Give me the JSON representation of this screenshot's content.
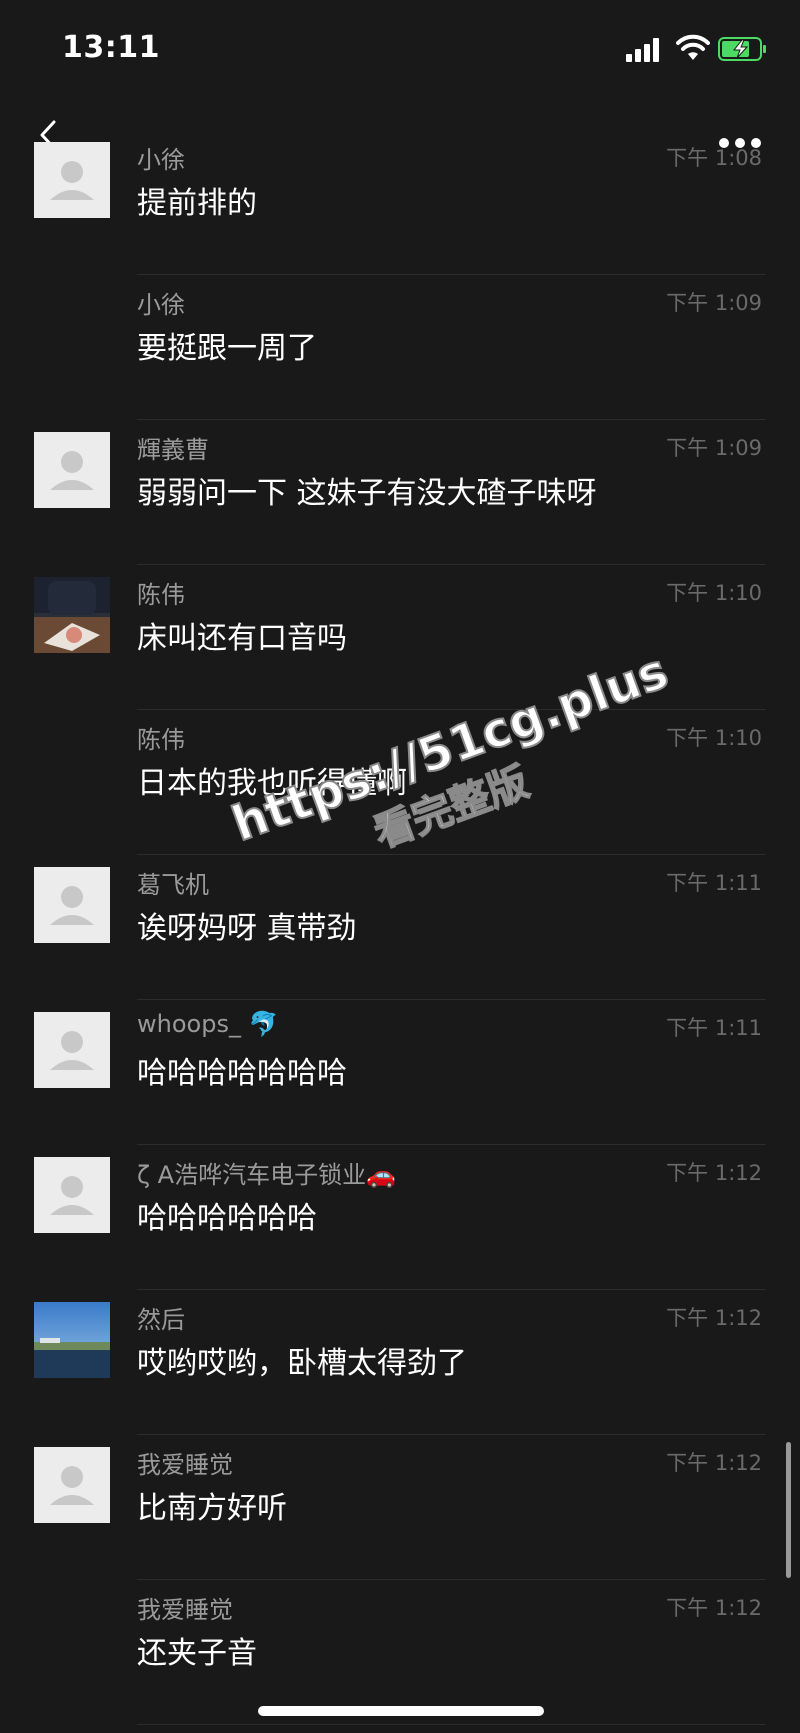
{
  "status_bar": {
    "time": "13:11"
  },
  "icons": {
    "back": "back-arrow-icon",
    "more": "more-dots-icon",
    "signal": "cellular-signal-icon",
    "wifi": "wifi-icon",
    "battery": "battery-charging-icon"
  },
  "colors": {
    "background": "#191919",
    "name": "#9a9a9a",
    "timestamp": "#6a6a6a",
    "battery": "#4cd964"
  },
  "messages": [
    {
      "name": "小徐",
      "time": "下午 1:08",
      "text": "提前排的",
      "avatar": "default"
    },
    {
      "name": "小徐",
      "time": "下午 1:09",
      "text": "要挺跟一周了",
      "avatar": "none"
    },
    {
      "name": "輝義曹",
      "time": "下午 1:09",
      "text": "弱弱问一下 这妹子有没大碴子味呀",
      "avatar": "default"
    },
    {
      "name": "陈伟",
      "time": "下午 1:10",
      "text": "床叫还有口音吗",
      "avatar": "photo-table"
    },
    {
      "name": "陈伟",
      "time": "下午 1:10",
      "text": "日本的我也听得懂啊",
      "avatar": "none"
    },
    {
      "name": "葛飞机",
      "time": "下午 1:11",
      "text": "诶呀妈呀 真带劲",
      "avatar": "default"
    },
    {
      "name": "whoops_",
      "time": "下午 1:11",
      "text": "哈哈哈哈哈哈哈",
      "avatar": "default",
      "name_emoji": "🐬"
    },
    {
      "name": "ζ A浩哗汽车电子锁业",
      "time": "下午 1:12",
      "text": "哈哈哈哈哈哈",
      "avatar": "default",
      "name_emoji": "🚗"
    },
    {
      "name": "然后",
      "time": "下午 1:12",
      "text": "哎哟哎哟，卧槽太得劲了",
      "avatar": "photo-sky"
    },
    {
      "name": "我爱睡觉",
      "time": "下午 1:12",
      "text": "比南方好听",
      "avatar": "default"
    },
    {
      "name": "我爱睡觉",
      "time": "下午 1:12",
      "text": "还夹子音",
      "avatar": "none"
    }
  ],
  "watermark": {
    "line1": "https://51cg.plus",
    "line2": "看完整版"
  }
}
